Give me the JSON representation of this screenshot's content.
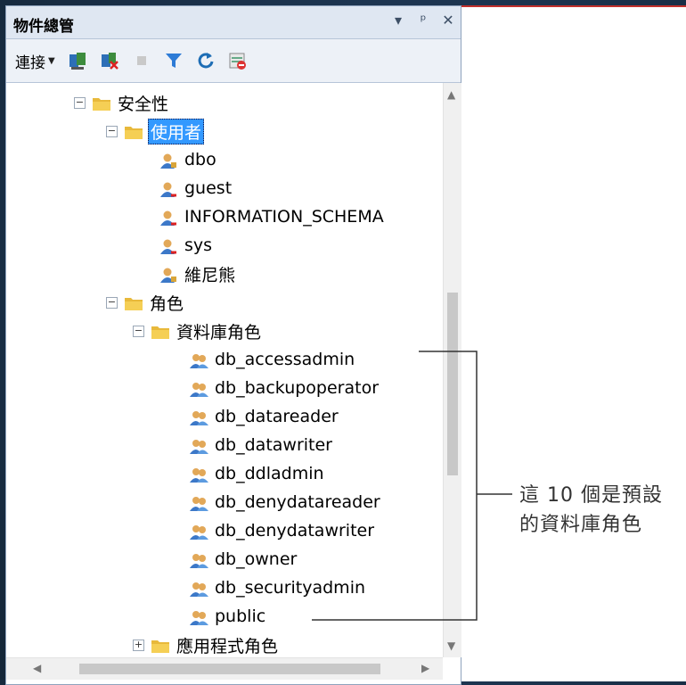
{
  "window": {
    "title": "物件總管",
    "pin_icon": "pin-icon",
    "close_icon": "close-icon"
  },
  "toolbar": {
    "connect_label": "連接",
    "buttons": [
      "connect-server-icon",
      "disconnect-icon",
      "stop-icon",
      "filter-icon",
      "refresh-icon",
      "activity-monitor-icon"
    ]
  },
  "tree": {
    "security": "安全性",
    "users_folder": "使用者",
    "users": [
      "dbo",
      "guest",
      "INFORMATION_SCHEMA",
      "sys",
      "維尼熊"
    ],
    "roles_folder": "角色",
    "db_roles_folder": "資料庫角色",
    "db_roles": [
      "db_accessadmin",
      "db_backupoperator",
      "db_datareader",
      "db_datawriter",
      "db_ddladmin",
      "db_denydatareader",
      "db_denydatawriter",
      "db_owner",
      "db_securityadmin",
      "public"
    ],
    "app_roles_folder": "應用程式角色"
  },
  "annotation": {
    "line1": "這 10 個是預設",
    "line2": "的資料庫角色"
  },
  "colors": {
    "selection": "#3399ff",
    "frame_border": "#c2302c",
    "titlebar": "#dfe7f2"
  }
}
